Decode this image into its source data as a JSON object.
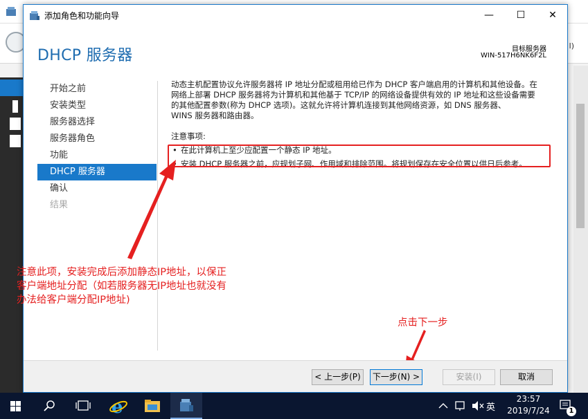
{
  "window": {
    "title": "添加角色和功能向导",
    "minimize_glyph": "—",
    "maximize_glyph": "☐",
    "close_glyph": "✕"
  },
  "background_app": {
    "right_text": "l)"
  },
  "page": {
    "heading": "DHCP 服务器",
    "destination_label": "目标服务器",
    "destination_server": "WIN-517H6NK6F2L"
  },
  "nav": [
    {
      "label": "开始之前",
      "state": "normal"
    },
    {
      "label": "安装类型",
      "state": "normal"
    },
    {
      "label": "服务器选择",
      "state": "normal"
    },
    {
      "label": "服务器角色",
      "state": "normal"
    },
    {
      "label": "功能",
      "state": "normal"
    },
    {
      "label": "DHCP 服务器",
      "state": "selected"
    },
    {
      "label": "确认",
      "state": "normal"
    },
    {
      "label": "结果",
      "state": "disabled"
    }
  ],
  "content": {
    "description_lines": [
      "动态主机配置协议允许服务器将 IP 地址分配或租用给已作为 DHCP 客户端启用的计算机和其他设备。在",
      "网络上部署 DHCP 服务器将为计算机和其他基于 TCP/IP 的网络设备提供有效的 IP 地址和这些设备需要",
      "的其他配置参数(称为 DHCP 选项)。这就允许将计算机连接到其他网络资源，如 DNS 服务器、",
      "WINS 服务器和路由器。"
    ],
    "notes_label": "注意事项:",
    "notes": [
      "在此计算机上至少应配置一个静态 IP 地址。",
      "安装 DHCP 服务器之前，应规划子网、作用域和排除范围。将规划保存在安全位置以供日后参考。"
    ],
    "bullet": "•"
  },
  "annotations": {
    "left_lines": [
      "注意此项，安装完成后添加静态IP地址，以保正",
      "客户端地址分配（如若服务器无IP地址也就没有",
      "办法给客户端分配IP地址)"
    ],
    "right": "点击下一步"
  },
  "footer": {
    "prev": "< 上一步(P)",
    "next": "下一步(N) >",
    "install": "安装(I)",
    "cancel": "取消"
  },
  "taskbar": {
    "time": "23:57",
    "date": "2019/7/24",
    "ime": "英",
    "notifications": "1"
  },
  "colors": {
    "accent": "#1979ca",
    "annotation": "#e52020",
    "taskbar": "#0a1630"
  }
}
